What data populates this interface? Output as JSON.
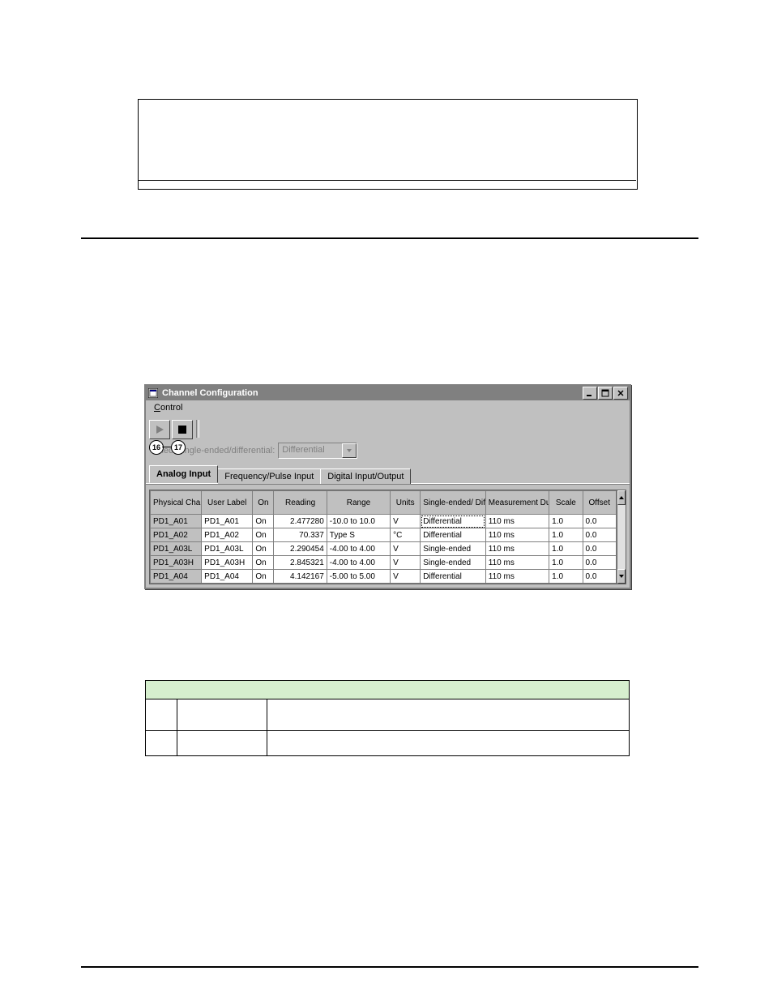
{
  "window": {
    "title": "Channel Configuration"
  },
  "menubar": {
    "control": "Control",
    "control_underline": "C"
  },
  "toolbar": {
    "callout16": "16",
    "callout17": "17"
  },
  "selectRow": {
    "label": "Select single-ended/differential:",
    "value": "Differential"
  },
  "tabs": {
    "analogInput": "Analog Input",
    "frequencyPulseInput": "Frequency/Pulse Input",
    "digitalIO": "Digital Input/Output"
  },
  "grid": {
    "headers": {
      "physicalChannel": "Physical\nChannel",
      "userLabel": "User Label",
      "on": "On",
      "reading": "Reading",
      "range": "Range",
      "units": "Units",
      "singleDiff": "Single-ended/\nDifferential",
      "measDur": "Measurement\nDuration",
      "scale": "Scale",
      "offset": "Offset"
    },
    "rows": [
      {
        "phys": "PD1_A01",
        "label": "PD1_A01",
        "on": "On",
        "reading": "2.477280",
        "range": "-10.0 to 10.0",
        "units": "V",
        "sd": "Differential",
        "sd_hl": true,
        "dur": "110 ms",
        "scale": "1.0",
        "offset": "0.0"
      },
      {
        "phys": "PD1_A02",
        "label": "PD1_A02",
        "on": "On",
        "reading": "70.337",
        "range": "Type S",
        "units": "°C",
        "sd": "Differential",
        "dur": "110 ms",
        "scale": "1.0",
        "offset": "0.0"
      },
      {
        "phys": "PD1_A03L",
        "label": "PD1_A03L",
        "on": "On",
        "reading": "2.290454",
        "range": "-4.00 to 4.00",
        "units": "V",
        "sd": "Single-ended",
        "dur": "110 ms",
        "scale": "1.0",
        "offset": "0.0"
      },
      {
        "phys": "PD1_A03H",
        "label": "PD1_A03H",
        "on": "On",
        "reading": "2.845321",
        "range": "-4.00 to 4.00",
        "units": "V",
        "sd": "Single-ended",
        "dur": "110 ms",
        "scale": "1.0",
        "offset": "0.0"
      },
      {
        "phys": "PD1_A04",
        "label": "PD1_A04",
        "on": "On",
        "reading": "4.142167",
        "range": "-5.00 to 5.00",
        "units": "V",
        "sd": "Differential",
        "dur": "110 ms",
        "scale": "1.0",
        "offset": "0.0"
      }
    ]
  },
  "chart_data": {
    "type": "table",
    "title": "Channel Configuration — Analog Input",
    "columns": [
      "Physical Channel",
      "User Label",
      "On",
      "Reading",
      "Range",
      "Units",
      "Single-ended/Differential",
      "Measurement Duration",
      "Scale",
      "Offset"
    ],
    "rows": [
      [
        "PD1_A01",
        "PD1_A01",
        "On",
        2.47728,
        "-10.0 to 10.0",
        "V",
        "Differential",
        "110 ms",
        1.0,
        0.0
      ],
      [
        "PD1_A02",
        "PD1_A02",
        "On",
        70.337,
        "Type S",
        "°C",
        "Differential",
        "110 ms",
        1.0,
        0.0
      ],
      [
        "PD1_A03L",
        "PD1_A03L",
        "On",
        2.290454,
        "-4.00 to 4.00",
        "V",
        "Single-ended",
        "110 ms",
        1.0,
        0.0
      ],
      [
        "PD1_A03H",
        "PD1_A03H",
        "On",
        2.845321,
        "-4.00 to 4.00",
        "V",
        "Single-ended",
        "110 ms",
        1.0,
        0.0
      ],
      [
        "PD1_A04",
        "PD1_A04",
        "On",
        4.142167,
        "-5.00 to 5.00",
        "V",
        "Differential",
        "110 ms",
        1.0,
        0.0
      ]
    ]
  }
}
